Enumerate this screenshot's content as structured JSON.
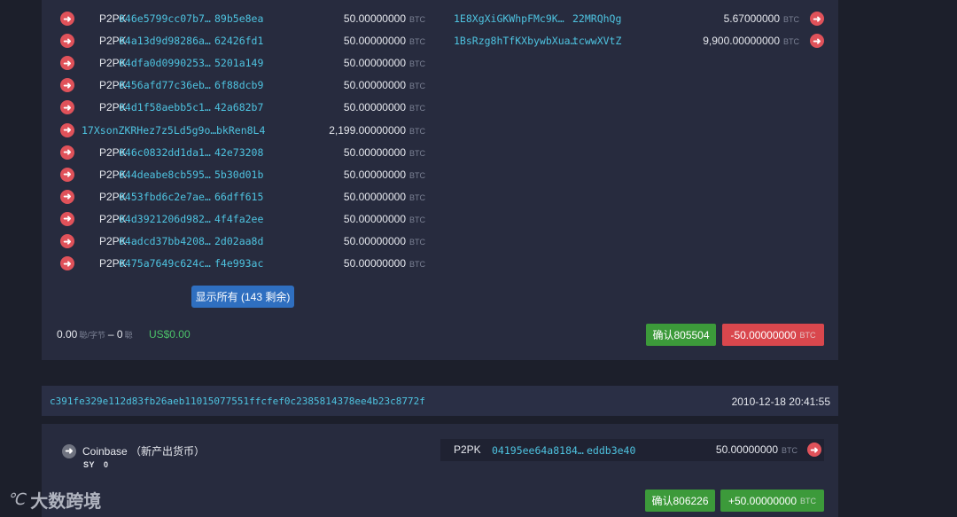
{
  "tx1": {
    "inputs": [
      {
        "type": "P2PK",
        "addr_a": "046e5799cc07b7…",
        "addr_b": "89b5e8ea",
        "amount": "50.00000000",
        "unit": "BTC"
      },
      {
        "type": "P2PK",
        "addr_a": "04a13d9d98286a…",
        "addr_b": "62426fd1",
        "amount": "50.00000000",
        "unit": "BTC"
      },
      {
        "type": "P2PK",
        "addr_a": "04dfa0d0990253…",
        "addr_b": "5201a149",
        "amount": "50.00000000",
        "unit": "BTC"
      },
      {
        "type": "P2PK",
        "addr_a": "0456afd77c36eb…",
        "addr_b": "6f88dcb9",
        "amount": "50.00000000",
        "unit": "BTC"
      },
      {
        "type": "P2PK",
        "addr_a": "04d1f58aebb5c1…",
        "addr_b": "42a682b7",
        "amount": "50.00000000",
        "unit": "BTC"
      },
      {
        "type": "",
        "addr_a": "17XsonZKRHez7z5Ld5g9o…",
        "addr_b": "bkRen8L4",
        "amount": "2,199.00000000",
        "unit": "BTC"
      },
      {
        "type": "P2PK",
        "addr_a": "046c0832dd1da1…",
        "addr_b": "42e73208",
        "amount": "50.00000000",
        "unit": "BTC"
      },
      {
        "type": "P2PK",
        "addr_a": "044deabe8cb595…",
        "addr_b": "5b30d01b",
        "amount": "50.00000000",
        "unit": "BTC"
      },
      {
        "type": "P2PK",
        "addr_a": "0453fbd6c2e7ae…",
        "addr_b": "66dff615",
        "amount": "50.00000000",
        "unit": "BTC"
      },
      {
        "type": "P2PK",
        "addr_a": "04d3921206d982…",
        "addr_b": "4f4fa2ee",
        "amount": "50.00000000",
        "unit": "BTC"
      },
      {
        "type": "P2PK",
        "addr_a": "04adcd37bb4208…",
        "addr_b": "2d02aa8d",
        "amount": "50.00000000",
        "unit": "BTC"
      },
      {
        "type": "P2PK",
        "addr_a": "0475a7649c624c…",
        "addr_b": "f4e993ac",
        "amount": "50.00000000",
        "unit": "BTC"
      }
    ],
    "outputs": [
      {
        "addr_a": "1E8XgXiGKWhpFMc9K…",
        "addr_b": "22MRQhQg",
        "amount": "5.67000000",
        "unit": "BTC"
      },
      {
        "addr_a": "1BsRzg8hTfKXbywbXua…",
        "addr_b": "tcwwXVtZ",
        "amount": "9,900.00000000",
        "unit": "BTC"
      }
    ],
    "show_all_label": "显示所有 (143 剩余)",
    "fee_rate": "0.00",
    "fee_rate_unit": "聪/字节",
    "fee_sep": "–",
    "fee_total": "0",
    "fee_total_unit": "聪",
    "fee_usd": "US$0.00",
    "confirmations": "确认805504",
    "net_amount": "-50.00000000",
    "net_unit": "BTC"
  },
  "tx2": {
    "hash": "c391fe329e112d83fb26aeb11015077551ffcfef0c2385814378ee4b23c8772f",
    "time": "2010-12-18 20:41:55",
    "coinbase_label": "Coinbase （新产出货币）",
    "sy_label": "SY",
    "sy_value": "0",
    "output": {
      "type": "P2PK",
      "addr_a": "04195ee64a8184…",
      "addr_b": "eddb3e40",
      "amount": "50.00000000",
      "unit": "BTC"
    },
    "confirmations": "确认806226",
    "net_amount": "+50.00000000",
    "net_unit": "BTC"
  },
  "icons": {
    "input_arrow": "arrow-right-circle-icon",
    "coinbase": "arrow-right-circle-grey-icon"
  },
  "colors": {
    "accent_link": "#4ec3e0",
    "negative": "#d9474d",
    "positive": "#3c9a3a",
    "button": "#2f6fc0"
  },
  "watermark": {
    "logo": "℃",
    "text": "大数跨境"
  }
}
